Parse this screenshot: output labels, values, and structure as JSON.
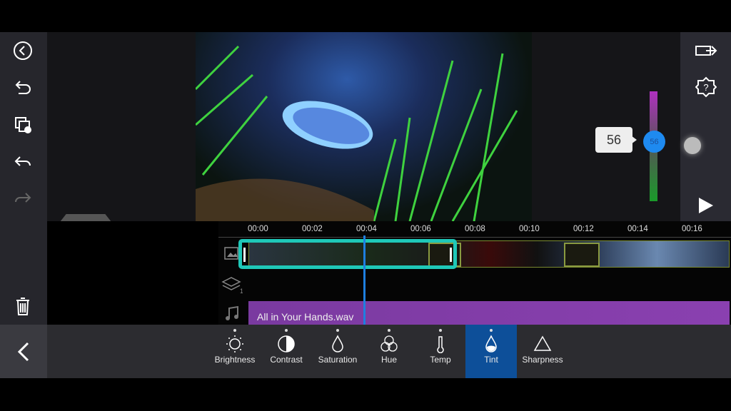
{
  "slider": {
    "label": "56",
    "knob_label": "56",
    "value": 56,
    "fraction": 0.55,
    "top_color": "#b030c0",
    "bottom_color": "#1a9a2a"
  },
  "timeline": {
    "ticks": [
      "00:00",
      "00:02",
      "00:04",
      "00:06",
      "00:08",
      "00:10",
      "00:12",
      "00:14",
      "00:16"
    ],
    "layer_count": "1",
    "audio_clip": "All in Your Hands.wav",
    "selection_color": "#1fc8b8",
    "playhead_color": "#1e7fe0"
  },
  "tools": [
    {
      "label": "Brightness",
      "icon": "sun-icon"
    },
    {
      "label": "Contrast",
      "icon": "contrast-icon"
    },
    {
      "label": "Saturation",
      "icon": "drop-icon"
    },
    {
      "label": "Hue",
      "icon": "rgb-icon"
    },
    {
      "label": "Temp",
      "icon": "thermometer-icon"
    },
    {
      "label": "Tint",
      "icon": "tint-drop-icon",
      "active": true
    },
    {
      "label": "Sharpness",
      "icon": "triangle-icon"
    }
  ],
  "colors": {
    "active_tool": "#0d4f99"
  }
}
